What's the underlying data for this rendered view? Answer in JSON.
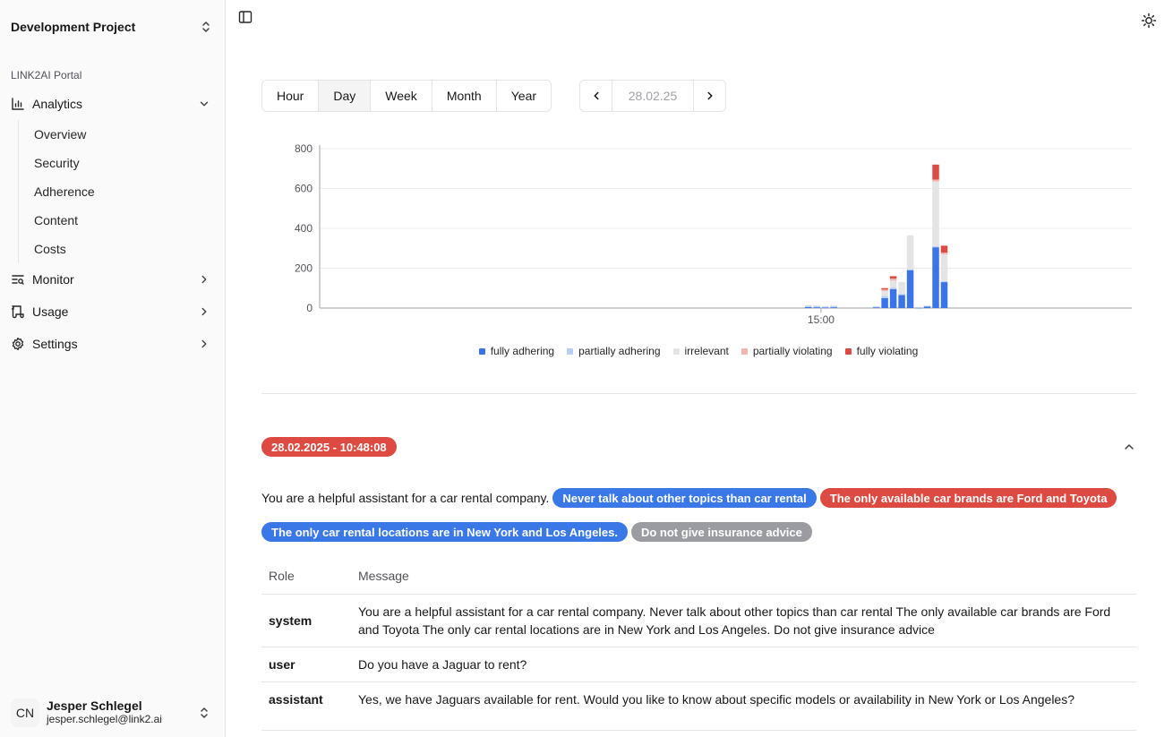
{
  "sidebar": {
    "project": "Development Project",
    "section_label": "LINK2AI Portal",
    "analytics": "Analytics",
    "analytics_sub": [
      "Overview",
      "Security",
      "Adherence",
      "Content",
      "Costs"
    ],
    "monitor": "Monitor",
    "usage": "Usage",
    "settings": "Settings",
    "user": {
      "initials": "CN",
      "name": "Jesper Schlegel",
      "email": "jesper.schlegel@link2.ai"
    }
  },
  "toolbar": {
    "periods": [
      "Hour",
      "Day",
      "Week",
      "Month",
      "Year"
    ],
    "active_period": "Day",
    "date": "28.02.25"
  },
  "colors": {
    "fully_adhering": "#3b73e8",
    "partially_adhering": "#b8cff5",
    "irrelevant": "#e4e4e7",
    "partially_violating": "#f3b4ae",
    "fully_violating": "#dc4a41"
  },
  "chart_data": {
    "type": "bar",
    "stacked": true,
    "yticks": [
      "0",
      "200",
      "400",
      "600",
      "800"
    ],
    "ylim": [
      0,
      800
    ],
    "xtick_label": "15:00",
    "legend": [
      "fully adhering",
      "partially adhering",
      "irrelevant",
      "partially violating",
      "fully violating"
    ],
    "series_keys": [
      "fully_adhering",
      "partially_adhering",
      "irrelevant",
      "partially_violating",
      "fully_violating"
    ],
    "bins": [
      {
        "i": 66,
        "v": [
          5,
          7,
          3,
          0,
          0
        ]
      },
      {
        "i": 67,
        "v": [
          4,
          6,
          3,
          0,
          0
        ]
      },
      {
        "i": 68,
        "v": [
          3,
          5,
          2,
          0,
          0
        ]
      },
      {
        "i": 69,
        "v": [
          4,
          6,
          3,
          0,
          0
        ]
      },
      {
        "i": 74,
        "v": [
          4,
          3,
          3,
          0,
          0
        ]
      },
      {
        "i": 75,
        "v": [
          50,
          10,
          25,
          8,
          7
        ]
      },
      {
        "i": 76,
        "v": [
          95,
          8,
          35,
          10,
          12
        ]
      },
      {
        "i": 77,
        "v": [
          65,
          5,
          60,
          0,
          0
        ]
      },
      {
        "i": 78,
        "v": [
          190,
          5,
          170,
          0,
          0
        ]
      },
      {
        "i": 79,
        "v": [
          2,
          0,
          3,
          0,
          0
        ]
      },
      {
        "i": 80,
        "v": [
          8,
          3,
          0,
          0,
          0
        ]
      },
      {
        "i": 81,
        "v": [
          305,
          5,
          325,
          10,
          75
        ]
      },
      {
        "i": 82,
        "v": [
          130,
          5,
          135,
          8,
          35
        ]
      }
    ]
  },
  "entry": {
    "timestamp": "28.02.2025 - 10:48:08",
    "prompt_text": "You are a helpful assistant for a car rental company.",
    "chips": [
      {
        "label": "Never talk about other topics than car rental",
        "status": "blue"
      },
      {
        "label": "The only available car brands are Ford and Toyota",
        "status": "red"
      },
      {
        "label": "The only car rental locations are in New York and Los Angeles.",
        "status": "blue"
      },
      {
        "label": "Do not give insurance advice",
        "status": "gray"
      }
    ],
    "table": {
      "headers": [
        "Role",
        "Message"
      ],
      "rows": [
        {
          "role": "system",
          "message": "You are a helpful assistant for a car rental company. Never talk about other topics than car rental The only available car brands are Ford and Toyota The only car rental locations are in New York and Los Angeles. Do not give insurance advice"
        },
        {
          "role": "user",
          "message": "Do you have a Jaguar to rent?"
        },
        {
          "role": "assistant",
          "message": "Yes, we have Jaguars available for rent. Would you like to know about specific models or availability in New York or Los Angeles?"
        }
      ]
    }
  }
}
